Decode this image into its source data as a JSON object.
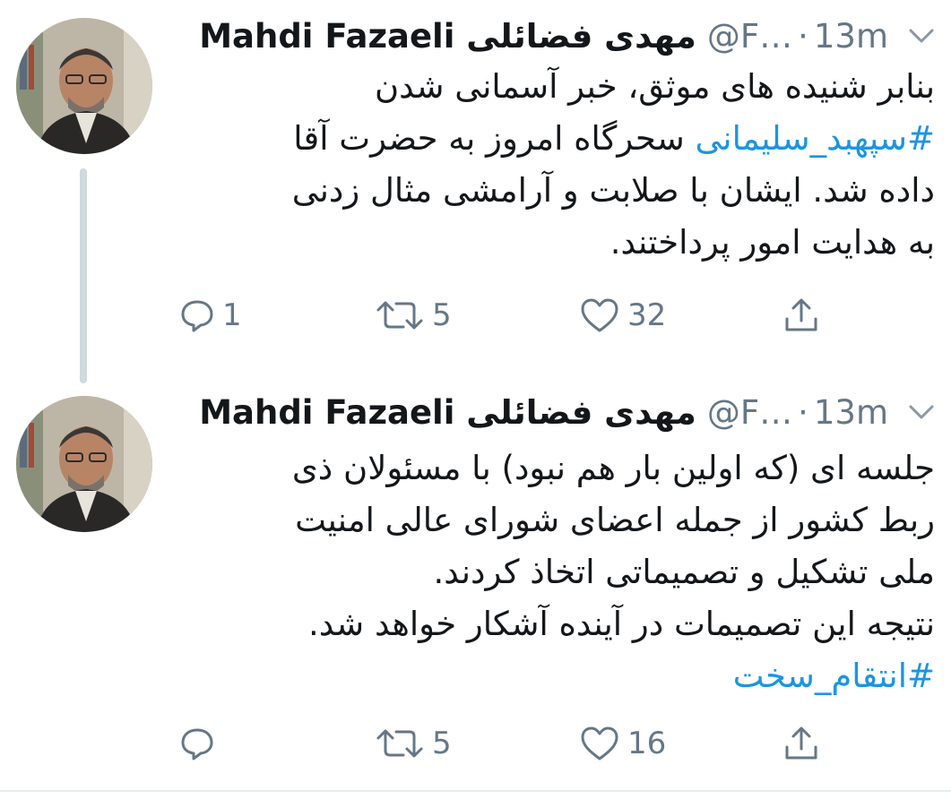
{
  "tweets": [
    {
      "author_name": "Mahdi Fazaeli",
      "author_name_fa": "مهدی فضائلی",
      "handle": "@F…",
      "separator": "·",
      "time": "13m",
      "lines": [
        "بنابر شنیده های موثق، خبر آسمانی شدن",
        "سحرگاه امروز به حضرت آقا",
        "داده شد. ایشان با صلابت و آرامشی مثال زدنی",
        "به هدایت امور پرداختند."
      ],
      "hashtag": "#سپهبد_سلیمانی",
      "replies": "1",
      "retweets": "5",
      "likes": "32"
    },
    {
      "author_name": "Mahdi Fazaeli",
      "author_name_fa": "مهدی فضائلی",
      "handle": "@F…",
      "separator": "·",
      "time": "13m",
      "lines": [
        "جلسه ای (که اولین بار هم نبود) با مسئولان ذی",
        "ربط کشور از جمله اعضای شورای عالی امنیت",
        "ملی تشکیل و تصمیماتی اتخاذ کردند.",
        "نتیجه این تصمیمات در آینده آشکار خواهد شد."
      ],
      "hashtag": "#انتقام_سخت",
      "replies": "",
      "retweets": "5",
      "likes": "16"
    }
  ],
  "icons": [
    "avatar-photo",
    "chevron-down-icon",
    "reply-icon",
    "retweet-icon",
    "like-icon",
    "share-icon"
  ],
  "colors": {
    "hashtag": "#1b95e0",
    "muted": "#657786",
    "thread_line": "#cfd9de"
  }
}
